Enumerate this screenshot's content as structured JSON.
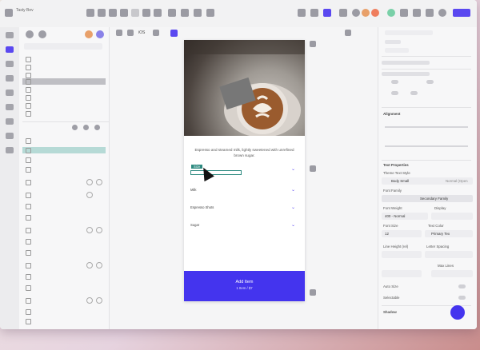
{
  "app": {
    "window_title": "Tasty Bev",
    "accent_color": "#4434ee",
    "overlay_colors": [
      "#e8a06a",
      "#ef7e5e",
      "#7ad0a8",
      "#6aa6e8"
    ]
  },
  "canvas": {
    "device_tag": "iOS",
    "phone": {
      "description": "Espresso and steamed milk, lightly sweetened with unrefined brown sugar.",
      "options": [
        {
          "label": "Size",
          "selected": true
        },
        {
          "label": "Milk"
        },
        {
          "label": "Espresso Shots"
        },
        {
          "label": "Sugar"
        }
      ],
      "add_button": {
        "label": "Add Item",
        "sublabel": "1 Item / $7"
      }
    }
  },
  "right_panel": {
    "alignment_heading": "Alignment",
    "text_properties_heading": "Text Properties",
    "theme_text_style_label": "Theme Text Style",
    "text_style_value": "Body Small",
    "text_style_secondary": "Normal (Open",
    "font_family_label": "Font Family",
    "font_family_value": "Secondary Family",
    "font_weight_label": "Font Weight",
    "font_weight_value": "400 - Normal",
    "display_label": "Display",
    "font_size_label": "Font Size",
    "font_size_value": "12",
    "text_color_label": "Text Color",
    "text_color_value": "Primary Tex",
    "line_height_label": "Line Height (rel)",
    "letter_spacing_label": "Letter Spacing",
    "max_lines_label": "Max Lines",
    "auto_size_label": "Auto Size",
    "selectable_label": "Selectable",
    "shadow_label": "Shadow"
  }
}
